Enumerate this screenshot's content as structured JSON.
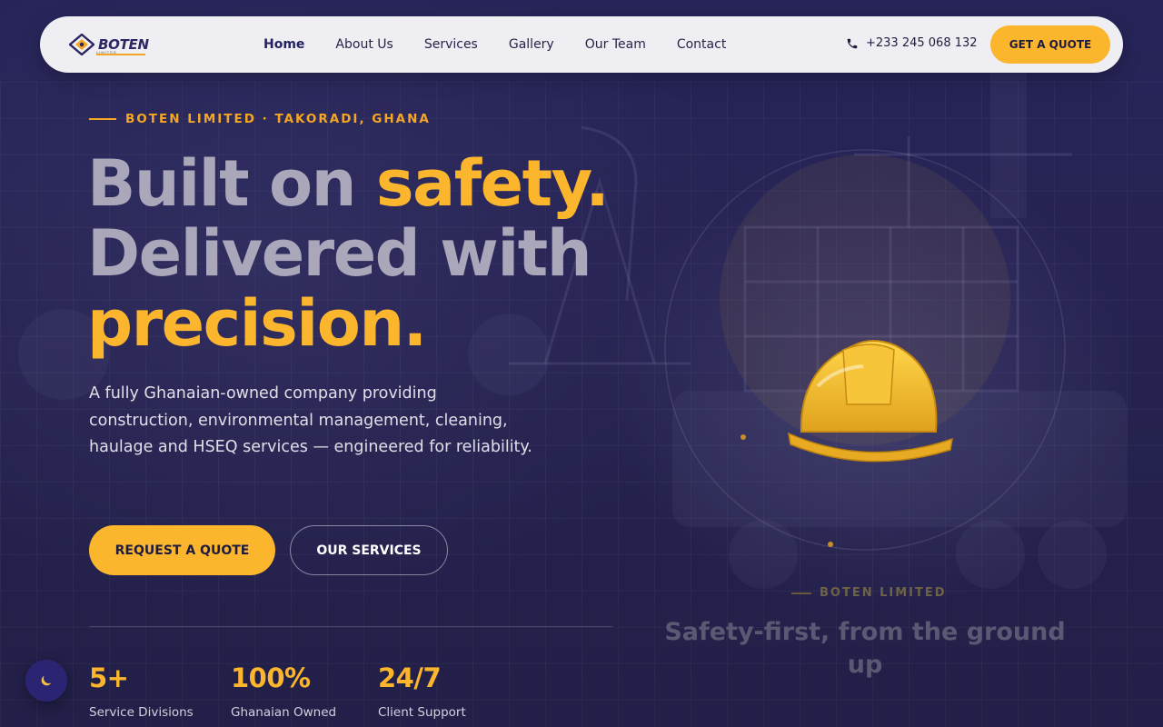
{
  "nav": {
    "logo_text": "BOTEN",
    "logo_subtext": "LIMITED",
    "items": [
      {
        "label": "Home",
        "active": true
      },
      {
        "label": "About Us",
        "active": false
      },
      {
        "label": "Services",
        "active": false
      },
      {
        "label": "Gallery",
        "active": false
      },
      {
        "label": "Our Team",
        "active": false
      },
      {
        "label": "Contact",
        "active": false
      }
    ],
    "phone": "+233 245 068 132",
    "phone_icon": "phone-icon",
    "cta_label": "GET A QUOTE"
  },
  "hero": {
    "eyebrow": "BOTEN LIMITED · TAKORADI, GHANA",
    "headline": {
      "line1_plain": "Built on ",
      "line1_accent": "safety.",
      "line2_plain": "Delivered with",
      "line3_accent": "precision."
    },
    "description": "A fully Ghanaian-owned company providing construction, environmental management, cleaning, haulage and HSEQ services — engineered for reliability.",
    "primary_button": "REQUEST A QUOTE",
    "secondary_button": "OUR SERVICES",
    "stats": [
      {
        "value": "5+",
        "label": "Service Divisions"
      },
      {
        "value": "100%",
        "label": "Ghanaian Owned"
      },
      {
        "value": "24/7",
        "label": "Client Support"
      }
    ]
  },
  "visual": {
    "icon": "hard-hat-icon",
    "eyebrow": "BOTEN LIMITED",
    "title": "Safety-first, from the ground up"
  },
  "theme_toggle_icon": "moon-icon",
  "colors": {
    "accent": "#fbb62e",
    "background": "#25224f",
    "nav_bg": "#efeff3"
  }
}
